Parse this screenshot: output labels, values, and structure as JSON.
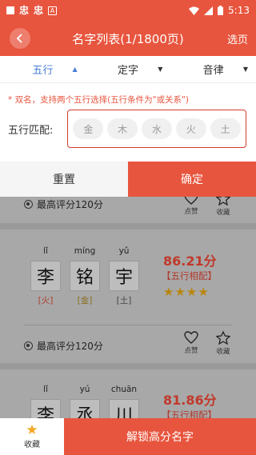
{
  "statusbar": {
    "left_glyphs": [
      "忠",
      "忠"
    ],
    "a_badge": "A",
    "time": "5:13"
  },
  "header": {
    "title": "名字列表(1/1800页)",
    "options_label": "选页"
  },
  "tabs": [
    {
      "label": "五行",
      "caret": "▲",
      "active": true
    },
    {
      "label": "定字",
      "caret": "▼",
      "active": false
    },
    {
      "label": "音律",
      "caret": "▼",
      "active": false
    }
  ],
  "filter": {
    "note": "* 双名，支持两个五行选择(五行条件为\"或关系\")",
    "label": "五行匹配:",
    "elements": [
      "金",
      "木",
      "水",
      "火",
      "土"
    ]
  },
  "actions": {
    "reset": "重置",
    "confirm": "确定"
  },
  "cards": [
    {
      "best_score": "最高评分120分",
      "like": "点赞",
      "collect": "收藏",
      "chars": [
        {
          "pinyin": "",
          "hanzi": "",
          "element": ""
        }
      ]
    },
    {
      "best_score": "",
      "chars": [
        {
          "pinyin": "lǐ",
          "hanzi": "李",
          "element": "[火]"
        },
        {
          "pinyin": "míng",
          "hanzi": "铭",
          "element": "[金]"
        },
        {
          "pinyin": "yǔ",
          "hanzi": "宇",
          "element": "[土]"
        }
      ],
      "score": "86.21分",
      "match": "【五行相配】",
      "stars": "★★★★"
    },
    {
      "best_score": "最高评分120分",
      "like": "点赞",
      "collect": "收藏",
      "chars": [
        {
          "pinyin": "lǐ",
          "hanzi": "李",
          "element": ""
        },
        {
          "pinyin": "yú",
          "hanzi": "丞",
          "element": ""
        },
        {
          "pinyin": "chuān",
          "hanzi": "川",
          "element": ""
        }
      ],
      "score": "81.86分",
      "match": "【五行相配】"
    }
  ],
  "bottom": {
    "favorites": "收藏",
    "unlock": "解锁高分名字"
  },
  "colors": {
    "accent": "#e8553e",
    "element_fire": "#b03a2e",
    "element_metal": "#9a7d2e",
    "element_earth": "#5a5a5a"
  }
}
